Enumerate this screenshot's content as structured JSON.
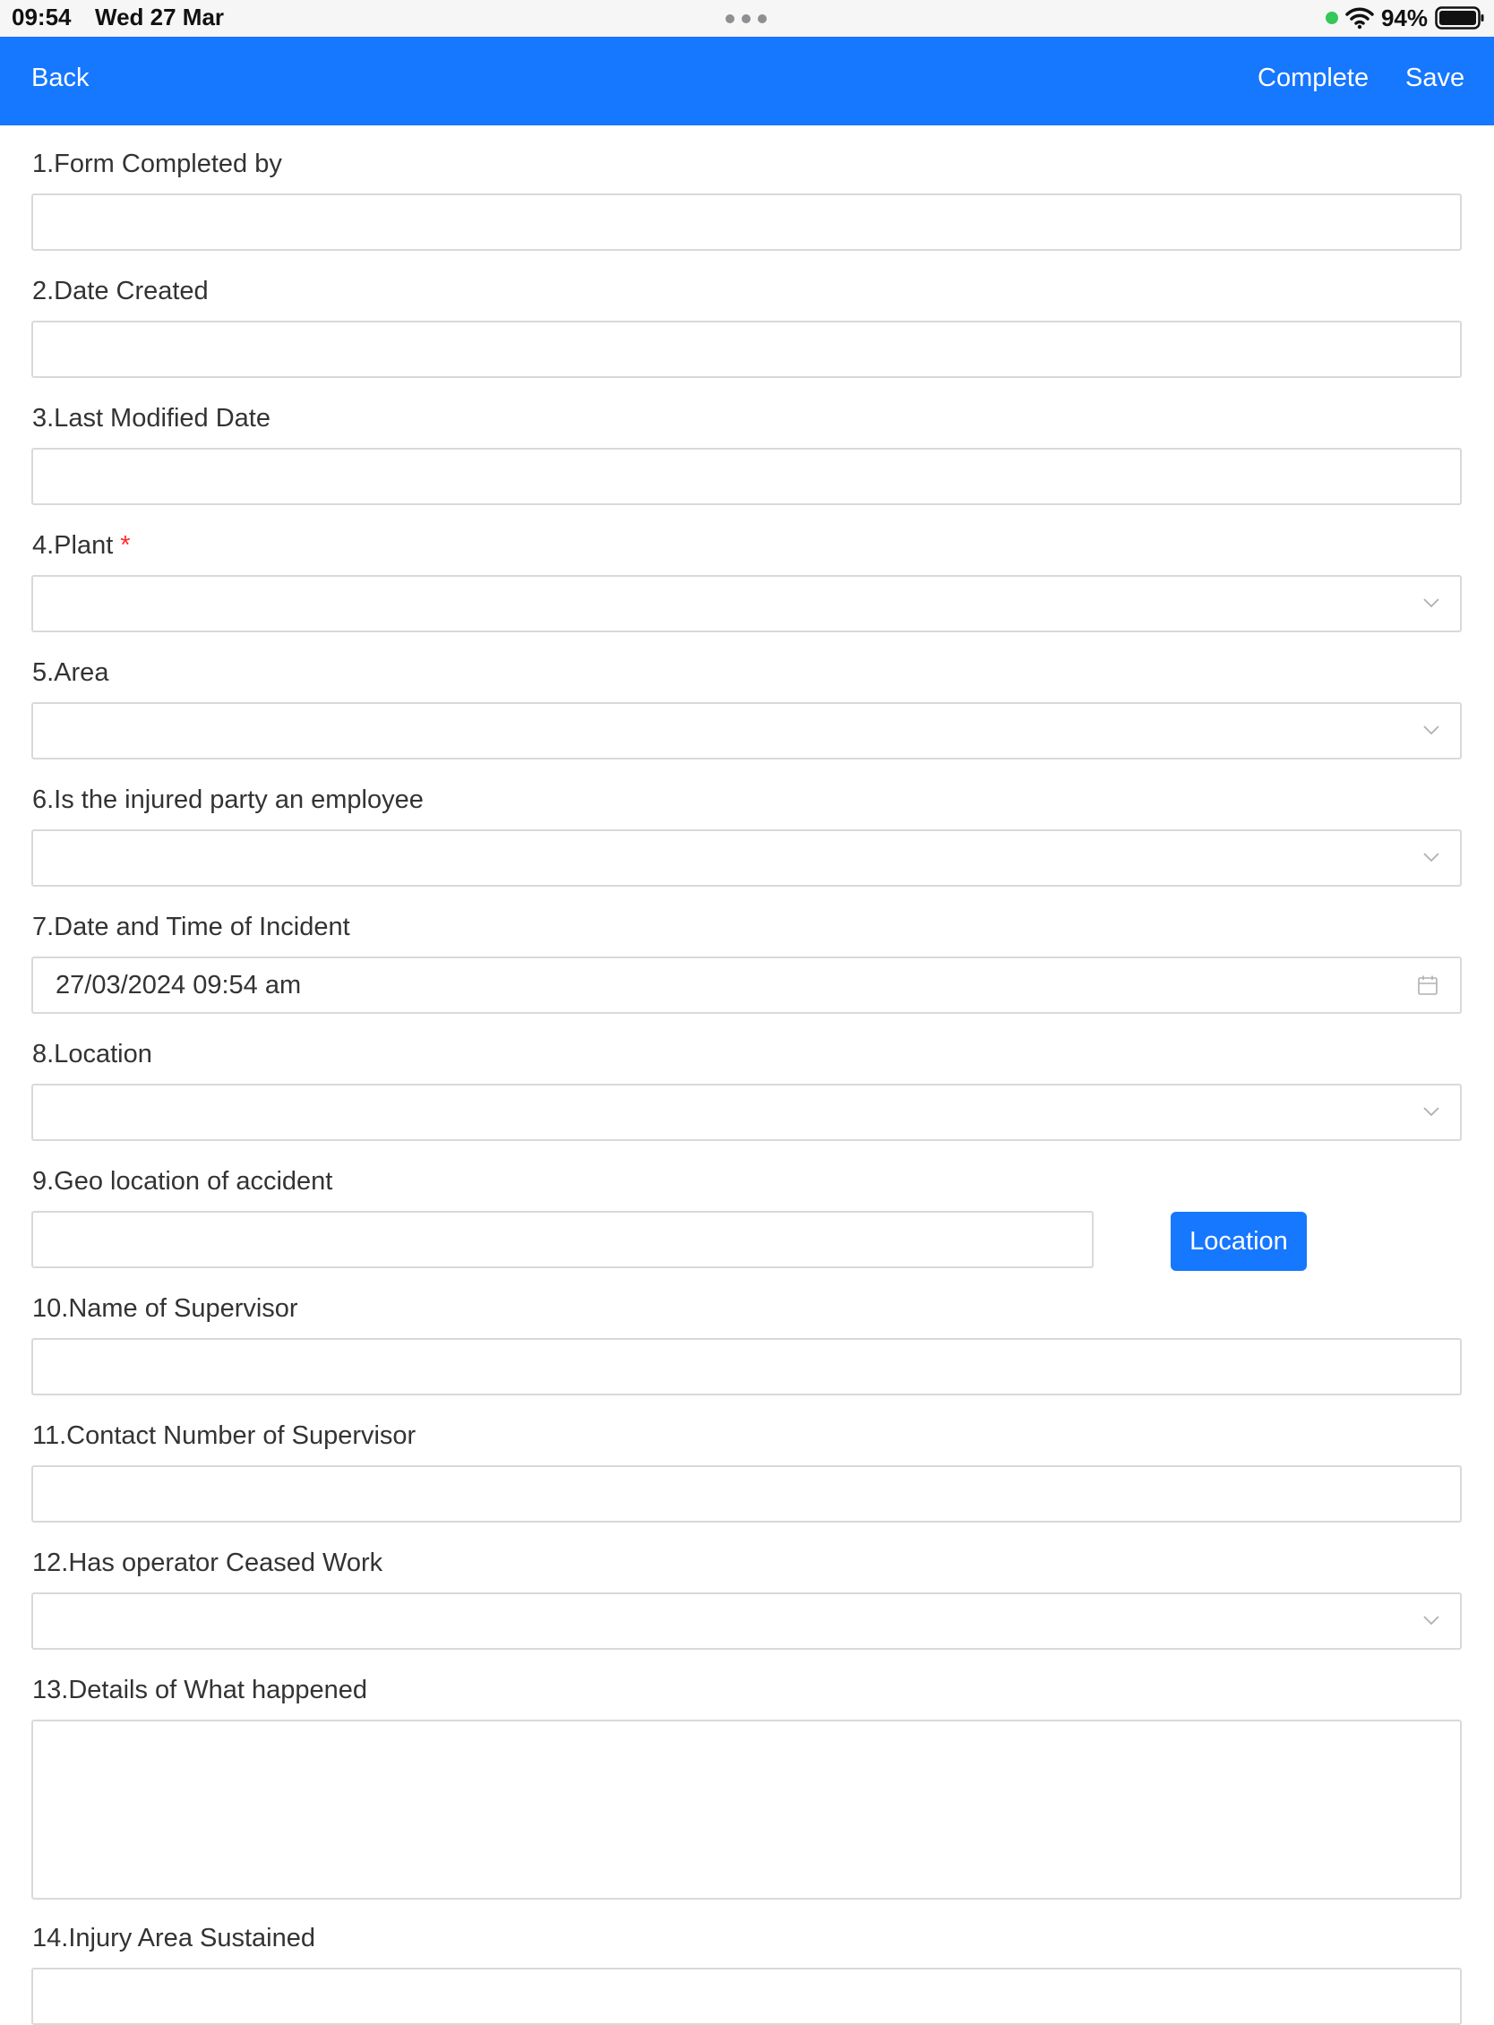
{
  "status_bar": {
    "time": "09:54",
    "date": "Wed 27 Mar",
    "battery": "94%"
  },
  "nav": {
    "back_label": "Back",
    "complete_label": "Complete",
    "save_label": "Save"
  },
  "colors": {
    "accent": "#1677ff",
    "required": "#ff2a2a",
    "border": "#d9d9d9"
  },
  "fields": [
    {
      "label": "1.Form Completed by",
      "type": "text",
      "value": ""
    },
    {
      "label": "2.Date Created",
      "type": "text",
      "value": ""
    },
    {
      "label": "3.Last Modified Date",
      "type": "text",
      "value": ""
    },
    {
      "label": "4.Plant",
      "required": "*",
      "type": "select",
      "value": ""
    },
    {
      "label": "5.Area",
      "type": "select",
      "value": ""
    },
    {
      "label": "6.Is the injured party an employee",
      "type": "select",
      "value": ""
    },
    {
      "label": "7.Date and Time of Incident",
      "type": "datetime",
      "value": "27/03/2024 09:54 am"
    },
    {
      "label": "8.Location",
      "type": "select",
      "value": ""
    },
    {
      "label": "9.Geo location of accident",
      "type": "text",
      "value": "",
      "button_label": "Location"
    },
    {
      "label": "10.Name of Supervisor",
      "type": "text",
      "value": ""
    },
    {
      "label": "11.Contact Number of Supervisor",
      "type": "text",
      "value": ""
    },
    {
      "label": "12.Has operator Ceased Work",
      "type": "select",
      "value": ""
    },
    {
      "label": "13.Details of What happened",
      "type": "textarea",
      "value": ""
    },
    {
      "label": "14.Injury Area Sustained",
      "type": "text",
      "value": ""
    }
  ]
}
